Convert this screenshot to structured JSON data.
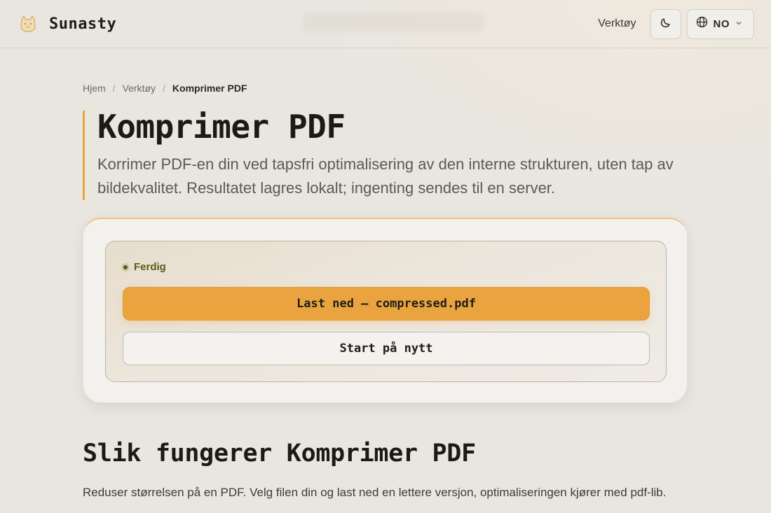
{
  "header": {
    "brand": "Sunasty",
    "nav_tools": "Verktøy",
    "lang": "NO"
  },
  "breadcrumb": {
    "home": "Hjem",
    "tools": "Verktøy",
    "current": "Komprimer PDF"
  },
  "page": {
    "title": "Komprimer PDF",
    "description": "Korrimer PDF-en din ved tapsfri optimalisering av den interne strukturen, uten tap av bildekvalitet. Resultatet lagres lokalt; ingenting sendes til en server."
  },
  "result": {
    "status": "Ferdig",
    "download_label": "Last ned — compressed.pdf",
    "restart_label": "Start på nytt"
  },
  "section": {
    "title": "Slik fungerer Komprimer PDF",
    "text": "Reduser størrelsen på en PDF. Velg filen din og last ned en lettere versjon, optimaliseringen kjører med pdf-lib."
  },
  "colors": {
    "accent": "#eaa43f",
    "status_green": "#56561d",
    "background": "#e9e6e0"
  },
  "icons": {
    "logo": "cat-logo-icon",
    "theme": "moon-icon",
    "language": "globe-icon",
    "dropdown": "chevron-down-icon"
  }
}
